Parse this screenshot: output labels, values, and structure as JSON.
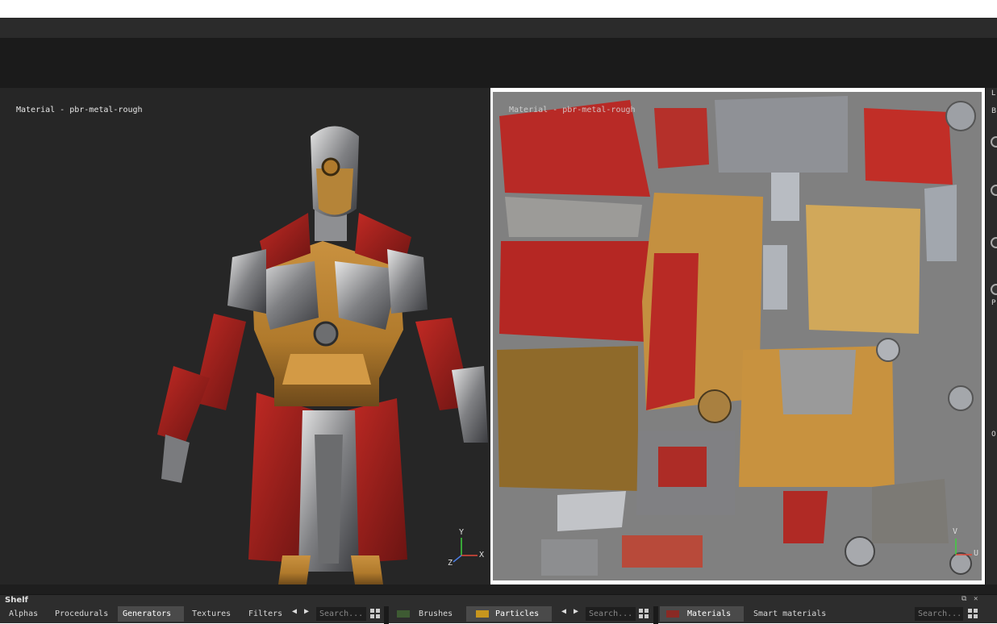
{
  "viewport3d": {
    "label": "Material - pbr-metal-rough"
  },
  "viewport2d": {
    "label": "Material - pbr-metal-rough"
  },
  "gizmo3d": {
    "y": "Y",
    "x": "X",
    "z": "Z"
  },
  "gizmo2d": {
    "v": "V",
    "u": "U"
  },
  "right_panel": {
    "letters": [
      "L",
      "B",
      "P"
    ],
    "bottom_value": "0"
  },
  "shelf": {
    "title": "Shelf",
    "left_tabs": [
      "Alphas",
      "Procedurals",
      "Generators",
      "Textures",
      "Filters"
    ],
    "active_left_tab": "Generators",
    "left_search": "Search...",
    "middle_tabs": [
      "Brushes",
      "Particles"
    ],
    "middle_search": "Search...",
    "right_tabs": [
      "Materials",
      "Smart materials"
    ],
    "right_search": "Search...",
    "colors": {
      "brushes": "#3e5b33",
      "particles": "#c8961e",
      "materials": "#8a2a24"
    }
  }
}
